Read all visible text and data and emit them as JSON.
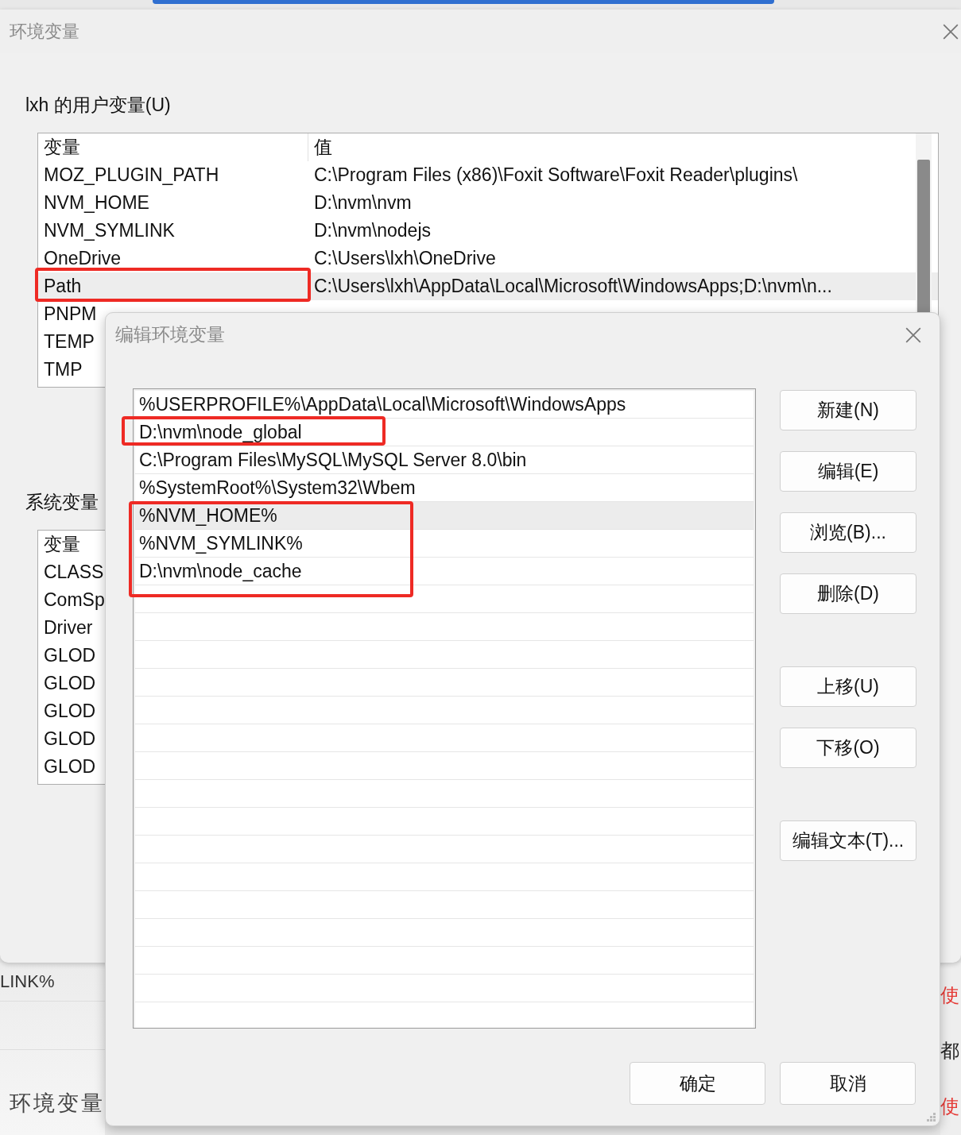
{
  "background_window": {
    "left_texts": [
      "LINK%"
    ],
    "caption": "环境变量",
    "right_texts": [
      {
        "text": "使",
        "color": "#e53935"
      },
      {
        "text": "都",
        "color": "#222222"
      },
      {
        "text": "使",
        "color": "#e53935"
      }
    ]
  },
  "window": {
    "title": "环境变量",
    "user_group": {
      "label": "lxh 的用户变量(U)",
      "columns": [
        "变量",
        "值"
      ],
      "rows": [
        {
          "name": "MOZ_PLUGIN_PATH",
          "value": "C:\\Program Files (x86)\\Foxit Software\\Foxit Reader\\plugins\\",
          "selected": false
        },
        {
          "name": "NVM_HOME",
          "value": "D:\\nvm\\nvm",
          "selected": false
        },
        {
          "name": "NVM_SYMLINK",
          "value": "D:\\nvm\\nodejs",
          "selected": false
        },
        {
          "name": "OneDrive",
          "value": "C:\\Users\\lxh\\OneDrive",
          "selected": false
        },
        {
          "name": "Path",
          "value": "C:\\Users\\lxh\\AppData\\Local\\Microsoft\\WindowsApps;D:\\nvm\\n...",
          "selected": true
        },
        {
          "name": "PNPM",
          "selected": false
        },
        {
          "name": "TEMP",
          "selected": false
        },
        {
          "name": "TMP",
          "selected": false
        }
      ]
    },
    "system_group": {
      "label": "系统变量",
      "columns": [
        "变量"
      ],
      "rows": [
        {
          "name": "CLASS",
          "selected": false
        },
        {
          "name": "ComSp",
          "selected": false
        },
        {
          "name": "Driver",
          "selected": false
        },
        {
          "name": "GLOD",
          "selected": false
        },
        {
          "name": "GLOD",
          "selected": false
        },
        {
          "name": "GLOD",
          "selected": false
        },
        {
          "name": "GLOD",
          "selected": false
        },
        {
          "name": "GLOD",
          "selected": false
        }
      ]
    }
  },
  "dialog": {
    "title": "编辑环境变量",
    "entries": [
      {
        "text": "%USERPROFILE%\\AppData\\Local\\Microsoft\\WindowsApps",
        "selected": false
      },
      {
        "text": "D:\\nvm\\node_global",
        "selected": false
      },
      {
        "text": "C:\\Program Files\\MySQL\\MySQL Server 8.0\\bin",
        "selected": false
      },
      {
        "text": "%SystemRoot%\\System32\\Wbem",
        "selected": false
      },
      {
        "text": "%NVM_HOME%",
        "selected": true
      },
      {
        "text": "%NVM_SYMLINK%",
        "selected": false
      },
      {
        "text": "D:\\nvm\\node_cache",
        "selected": false
      }
    ],
    "button_groups": [
      [
        "新建(N)",
        "编辑(E)",
        "浏览(B)...",
        "删除(D)"
      ],
      [
        "上移(U)",
        "下移(O)"
      ],
      [
        "编辑文本(T)..."
      ]
    ],
    "footer_buttons": [
      "确定",
      "取消"
    ]
  }
}
